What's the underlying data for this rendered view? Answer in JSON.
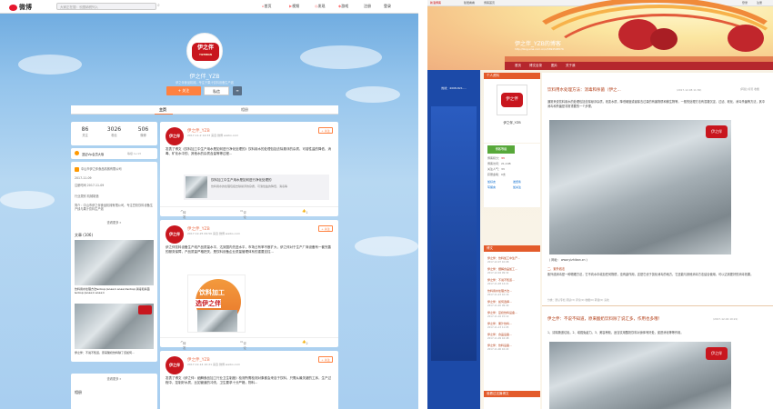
{
  "weibo": {
    "logo": "微博",
    "search_placeholder": "大家正在搜：长图纳税列入",
    "nav": [
      "首页",
      "视频",
      "发现",
      "游戏",
      "注册",
      "登录"
    ],
    "profile": {
      "avatar_text": "伊之伴",
      "avatar_sub": "YIZHIBAN",
      "name": "伊之伴_YZB",
      "intro": "伊之伴食品机械，专注于果汁饮料设备生产线",
      "follow_label": "+ 关注",
      "message_label": "私信",
      "more_label": "≡"
    },
    "tabs": [
      "主页",
      "相册"
    ],
    "stats": [
      {
        "value": "86",
        "label": "关注"
      },
      {
        "value": "3026",
        "label": "粉丝"
      },
      {
        "value": "506",
        "label": "微博"
      }
    ],
    "level": "蓝钻Vip会员大咖",
    "level_extra": "等级 Lv.13",
    "info": [
      "中山市伊之伴食品机械有限公司",
      "2017-11-09",
      "注册时间 2017-11-09",
      "行业类别 机械制造",
      "简介：中山市伊之伴食品机械有限公司，专注豆奶饮料设备生产线与果汁饮料生产线"
    ],
    "more_label": "查看更多 »",
    "album_title": "文章 (106)",
    "album_caption1": "饮料用水处理方法&nbsp;(aoaa;k.aoaa;k&nbsp;消毒和杀菌&nbsp;(aoaa;k.aoaa;k",
    "album_caption2": "伊之伴：不说不知道，原来酸奶饮料除了该如何...",
    "album_more": "查看更多 »",
    "photos_title": "相册",
    "posts": [
      {
        "name": "伊之伴_YZB",
        "time": "2017-11-2 14:33 来自 微博 weibo.com",
        "text": "发表了博文《饮料加工中生产用水是如何进行净化处理的》饮料用水的处理包括去除悬浮的杂质、可溶性盐的降低、消毒、矿化水中的、其他水的杂质含量等等过程...",
        "link_title": "饮料加工中生产用水是如何进行净化处理的",
        "link_text": "饮料用水的处理包括去除悬浮的杂质，可溶性盐的降低，消毒等",
        "forward": "转发",
        "comment": "评论",
        "like": "1"
      },
      {
        "name": "伊之伴_YZB",
        "time": "2017-12-25 09:50 来自 微博 weibo.com",
        "text": "伊之伴饮料设备生产线产品质量水平，达到国内先进水平，市场占有率不断扩大，伊之伴对于生产厂商设备有一套完善的服务保障，产品质量严格把关，是饮料设备企业质量管理体系的重要支柱...",
        "img_text1": "饮料加工",
        "img_text2": "选伊之伴",
        "forward": "转发",
        "comment": "评论",
        "like": "2"
      },
      {
        "name": "伊之伴_YZB",
        "time": "2017-12-14 10:21 来自 微博 weibo.com",
        "text": "发表了博文《伊之伴：细解食品加工行业卫生制度》检测所需检测对象都会来自于饮料，只需从最关键的工序，生产过程中，控制好水质，比如管道的冲洗，卫生要求十分严格，物料...",
        "forward": "转发",
        "comment": "评论",
        "like": "1"
      }
    ]
  },
  "blog": {
    "top_links": [
      "新浪博客",
      "随便看看",
      "博客首页",
      "登录",
      "注册"
    ],
    "title": "伊之伴_YZB的博客",
    "url": "http://blog.sina.com.cn/u/5894598576",
    "nav": [
      "首页",
      "博文目录",
      "图片",
      "关于我"
    ],
    "ad_text": "热线：4008-821-...",
    "profile_header": "个人资料",
    "profile_name": "伊之伴_YZB",
    "profile_buttons": [
      "加好友",
      "发纸条",
      "写留言",
      "加关注"
    ],
    "visitor_label": "博客等级：",
    "level_badge": "博客等级",
    "stats": [
      {
        "label": "博客积分：",
        "value": "33"
      },
      {
        "label": "博客访问：",
        "value": "21,198"
      },
      {
        "label": "关注人气：",
        "value": "33"
      },
      {
        "label": "获赠金笔：",
        "value": "0支"
      }
    ],
    "list_header": "博文",
    "list_items": [
      {
        "title": "伊之伴：饮料加工中生产...",
        "date": "2017-12-07 10:08"
      },
      {
        "title": "伊之伴：细解食品加工...",
        "date": "2017-12-04 09:32"
      },
      {
        "title": "伊之伴：不说不知道...",
        "date": "2017-11-28 14:21"
      },
      {
        "title": "饮料用水处理方法...",
        "date": "2017-11-23 10:16"
      },
      {
        "title": "伊之伴：如何选择...",
        "date": "2017-11-20 09:40"
      },
      {
        "title": "伊之伴：豆奶饮料设备...",
        "date": "2017-11-16 15:12"
      },
      {
        "title": "伊之伴：果汁饮料...",
        "date": "2017-11-13 11:05"
      },
      {
        "title": "伊之伴：食品设备...",
        "date": "2017-11-09 16:48"
      },
      {
        "title": "伊之伴：饮料设备...",
        "date": "2017-11-06 10:22"
      }
    ],
    "visitors_header": "谁看过这篇博文",
    "article1": {
      "title": "饮料用水处理方法：消毒和杀菌（伊之...",
      "date": "(2017-12-08 11:30)",
      "tools": "[转载] 标签 收藏",
      "text": "通常来说饮料用水的处理包括去除悬浮杂质，改变水质，降低硬度或者除去过量的有害物质和微生物等，一般的处理方法有混凝沉淀、过滤、软化、消毒杀菌等方法，其中消毒和杀菌是非常重要的一个步骤。",
      "caption": "( 网址： www.yizhiban.cn )",
      "section": "二、紫外线法",
      "section_text": "紫外线消毒是一种物理方法，它不向水中增加任何物质，没有副作用，这是它优于氯化消毒的地方，它还能与其他消毒方法结合使用，可以达到更好的消毒效果。",
      "footer": "分类：默认专栏  阅读(3)  评论(0)  收藏(0)  转载(0)  喜欢"
    },
    "article2": {
      "title": "伊之伴：不说不知道，原来酸奶饮料除了说汇多，作用也多哦！",
      "date": "(2017-12-04 10:21)",
      "text": "1、清除肠道垃圾。2、增强免疫力。3、美容养颜，适当饮用酸奶饮料对身体有好处，促进消化等等作用。"
    },
    "photo_brand": "伊之伴"
  }
}
